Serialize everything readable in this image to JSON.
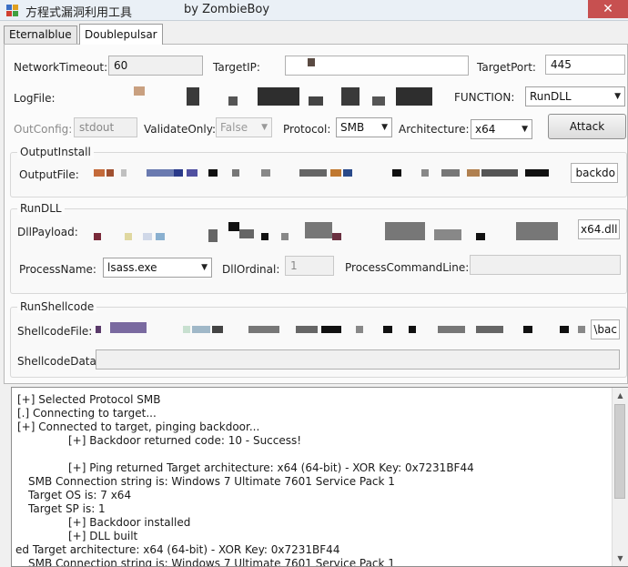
{
  "window": {
    "title": "方程式漏洞利用工具",
    "author": "by ZombieBoy",
    "close_glyph": "✕"
  },
  "tabs": [
    {
      "label": "Eternalblue",
      "active": false
    },
    {
      "label": "Doublepulsar",
      "active": true
    }
  ],
  "form": {
    "network_timeout": {
      "label": "NetworkTimeout:",
      "value": "60"
    },
    "target_ip": {
      "label": "TargetIP:",
      "value": ""
    },
    "target_port": {
      "label": "TargetPort:",
      "value": "445"
    },
    "log_file": {
      "label": "LogFile:",
      "value": ""
    },
    "function": {
      "label": "FUNCTION:",
      "value": "RunDLL"
    },
    "out_config": {
      "label": "OutConfig:",
      "value": "stdout"
    },
    "validate_only": {
      "label": "ValidateOnly:",
      "value": "False"
    },
    "protocol": {
      "label": "Protocol:",
      "value": "SMB"
    },
    "architecture": {
      "label": "Architecture:",
      "value": "x64"
    },
    "attack_button": "Attack"
  },
  "output_install": {
    "group_title": "OutputInstall",
    "output_file": {
      "label": "OutputFile:",
      "value_suffix": "backdo"
    }
  },
  "run_dll": {
    "group_title": "RunDLL",
    "dll_payload": {
      "label": "DllPayload:",
      "value_suffix": "x64.dll"
    },
    "process_name": {
      "label": "ProcessName:",
      "value": "lsass.exe"
    },
    "dll_ordinal": {
      "label": "DllOrdinal:",
      "value": "1"
    },
    "process_command_line": {
      "label": "ProcessCommandLine:",
      "value": ""
    }
  },
  "run_shellcode": {
    "group_title": "RunShellcode",
    "shellcode_file": {
      "label": "ShellcodeFile:",
      "value_suffix": "\\bac"
    },
    "shellcode_data": {
      "label": "ShellcodeData:",
      "value": ""
    }
  },
  "log": {
    "lines": [
      "[+] Selected Protocol SMB",
      "[.] Connecting to target...",
      "[+] Connected to target, pinging backdoor...",
      "[+] Backdoor returned code: 10 - Success!",
      "[+] Ping returned Target architecture: x64 (64-bit) - XOR Key: 0x7231BF44",
      "SMB Connection string is: Windows 7 Ultimate 7601 Service Pack 1",
      "Target OS is: 7 x64",
      "Target SP is: 1",
      "[+] Backdoor installed",
      "[+] DLL built",
      "ed Target architecture: x64 (64-bit) - XOR Key: 0x7231BF44",
      "SMB Connection string is: Windows 7 Ultimate 7601 Service Pack 1"
    ]
  },
  "colors": {
    "close_button": "#c75050",
    "scrollbar_thumb": "#cdcdcd"
  }
}
